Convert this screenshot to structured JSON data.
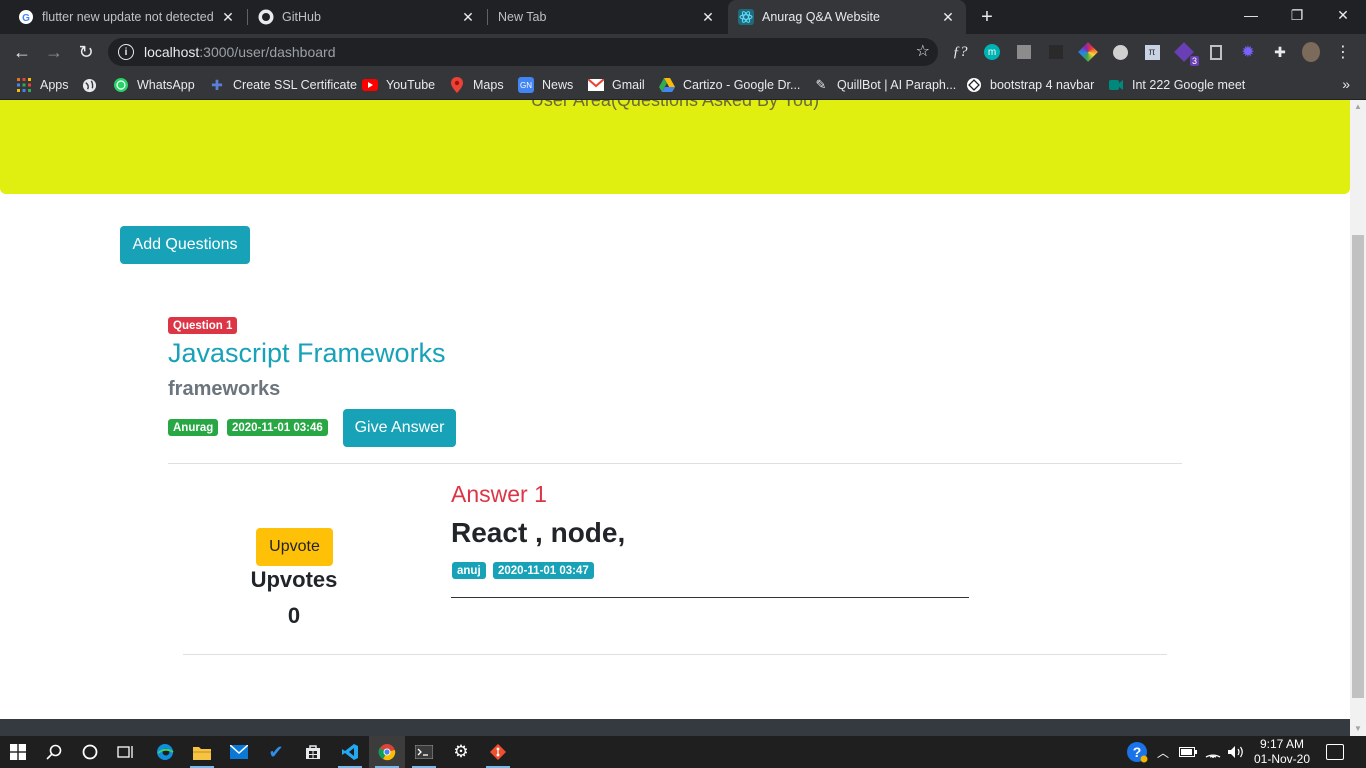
{
  "browser": {
    "tabs": [
      {
        "title": "flutter new update not detected - ",
        "icon": "google-icon"
      },
      {
        "title": "GitHub",
        "icon": "github-icon"
      },
      {
        "title": "New Tab",
        "icon": ""
      },
      {
        "title": "Anurag Q&A Website",
        "icon": "react-icon",
        "active": true
      }
    ],
    "address": {
      "host": "localhost",
      "path": ":3000/user/dashboard"
    },
    "bookmarks": [
      {
        "label": "Apps",
        "icon": "apps-grid-icon"
      },
      {
        "label": "",
        "icon": "globe-icon"
      },
      {
        "label": "WhatsApp",
        "icon": "whatsapp-icon"
      },
      {
        "label": "Create SSL Certificate",
        "icon": "puzzle-icon"
      },
      {
        "label": "YouTube",
        "icon": "youtube-icon"
      },
      {
        "label": "Maps",
        "icon": "maps-icon"
      },
      {
        "label": "News",
        "icon": "news-icon"
      },
      {
        "label": "Gmail",
        "icon": "gmail-icon"
      },
      {
        "label": "Cartizo - Google Dr...",
        "icon": "drive-icon"
      },
      {
        "label": "QuillBot | AI Paraph...",
        "icon": "quillbot-icon"
      },
      {
        "label": "bootstrap 4 navbar",
        "icon": "codepen-icon"
      },
      {
        "label": "Int 222 Google meet",
        "icon": "meet-icon"
      }
    ],
    "bookmarks_more": "»"
  },
  "page": {
    "jumbotron_text": "User Area(Questions Asked By You)",
    "add_questions_label": "Add Questions",
    "question": {
      "badge": "Question 1",
      "title": "Javascript Frameworks",
      "description": "frameworks",
      "author": "Anurag",
      "date": "2020-11-01 03:46",
      "give_answer_label": "Give Answer"
    },
    "answer": {
      "upvote_label": "Upvote",
      "upvotes_label": "Upvotes",
      "upvotes_count": "0",
      "title": "Answer 1",
      "text": "React , node,",
      "author": "anuj",
      "date": "2020-11-01 03:47"
    }
  },
  "taskbar": {
    "time": "9:17 AM",
    "date": "01-Nov-20",
    "extension_badge": "3"
  }
}
